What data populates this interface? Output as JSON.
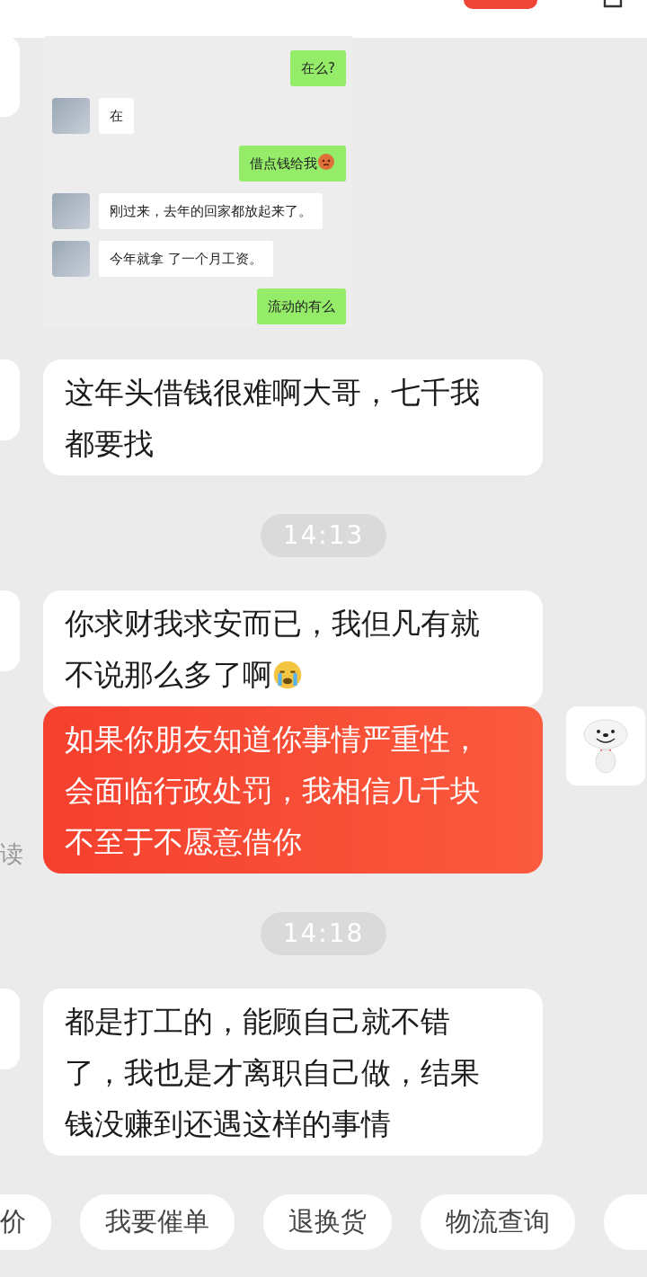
{
  "messages": [
    {
      "kind": "screenshot",
      "items": [
        {
          "kind": "sent",
          "text": "在么?",
          "has_emoji": false
        },
        {
          "kind": "received",
          "text": "在",
          "has_emoji": false
        },
        {
          "kind": "sent",
          "text": "借点钱给我",
          "has_emoji": true
        },
        {
          "kind": "received",
          "text": "刚过来，去年的回家都放起来了。",
          "has_emoji": false
        },
        {
          "kind": "received",
          "text": "今年就拿 了一个月工资。",
          "has_emoji": false
        },
        {
          "kind": "sent",
          "text": "流动的有么",
          "has_emoji": false
        }
      ]
    },
    {
      "kind": "received",
      "text": "这年头借钱很难啊大哥，七千我都要找",
      "has_emoji": false
    },
    {
      "kind": "time",
      "text": "14:13"
    },
    {
      "kind": "received",
      "text": "你求财我求安而已，我但凡有就不说那么多了啊",
      "has_emoji": true
    },
    {
      "kind": "sent",
      "text": "如果你朋友知道你事情严重性，会面临行政处罚，我相信几千块不至于不愿意借你",
      "read_status": "读",
      "has_emoji": false
    },
    {
      "kind": "time",
      "text": "14:18"
    },
    {
      "kind": "received",
      "text": "都是打工的，能顾自己就不错了，我也是才离职自己做，结果钱没赚到还遇这样的事情",
      "has_emoji": false
    }
  ],
  "quick_actions": [
    "价",
    "我要催单",
    "退换货",
    "物流查询"
  ]
}
